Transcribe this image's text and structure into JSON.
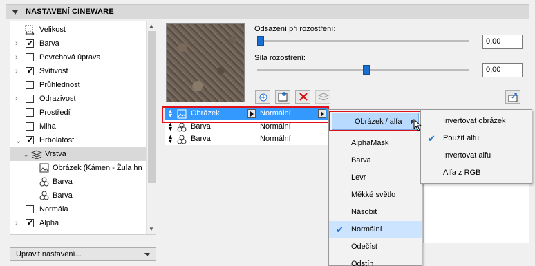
{
  "header": {
    "title": "NASTAVENÍ CINEWARE"
  },
  "tree": {
    "items": [
      {
        "label": "Velikost",
        "type": "icon",
        "icon": "resize-icon",
        "checked": null,
        "arrow": false
      },
      {
        "label": "Barva",
        "checked": true,
        "arrow": true
      },
      {
        "label": "Povrchová úprava",
        "checked": false,
        "arrow": true
      },
      {
        "label": "Svítivost",
        "checked": true,
        "arrow": true
      },
      {
        "label": "Průhlednost",
        "checked": false,
        "arrow": false
      },
      {
        "label": "Odrazivost",
        "checked": false,
        "arrow": true
      },
      {
        "label": "Prostředí",
        "checked": false,
        "arrow": false
      },
      {
        "label": "Mlha",
        "checked": false,
        "arrow": false
      },
      {
        "label": "Hrbolatost",
        "checked": true,
        "arrow": true,
        "expanded": true
      },
      {
        "label": "Vrstva",
        "selected": true
      },
      {
        "label": "Obrázek (Kámen - Žula hn"
      },
      {
        "label": "Barva"
      },
      {
        "label": "Barva"
      },
      {
        "label": "Normála",
        "checked": false
      },
      {
        "label": "Alpha",
        "checked": true,
        "arrow": true
      }
    ]
  },
  "bottom_button": {
    "label": "Upravit nastavení..."
  },
  "sliders": {
    "offset": {
      "label": "Odsazení při rozostření:",
      "value": "0,00",
      "level": 0.0
    },
    "strength": {
      "label": "Síla rozostření:",
      "value": "0,00",
      "level": 0.5
    }
  },
  "layers": [
    {
      "name": "Obrázek",
      "mode": "Normální",
      "icon": "image-icon",
      "selected": true
    },
    {
      "name": "Barva",
      "mode": "Normální",
      "icon": "color-icon"
    },
    {
      "name": "Barva",
      "mode": "Normální",
      "icon": "color-icon"
    }
  ],
  "menu": {
    "items": [
      {
        "label": "Obrázek / alfa",
        "highlighted": true,
        "submenu": true
      },
      {
        "label": "AlphaMask"
      },
      {
        "label": "Barva"
      },
      {
        "label": "Levr"
      },
      {
        "label": "Měkké světlo"
      },
      {
        "label": "Násobit"
      },
      {
        "label": "Normální",
        "checked": true
      },
      {
        "label": "Odečíst"
      },
      {
        "label": "Odstín"
      }
    ]
  },
  "submenu": {
    "items": [
      {
        "label": "Invertovat obrázek"
      },
      {
        "label": "Použít alfu",
        "checked": true
      },
      {
        "label": "Invertovat alfu"
      },
      {
        "label": "Alfa z RGB"
      }
    ]
  },
  "colors": {
    "accent": "#3399ff",
    "highlight": "#b8daff",
    "frame": "#e0101a",
    "slider": "#1a6fd1"
  }
}
